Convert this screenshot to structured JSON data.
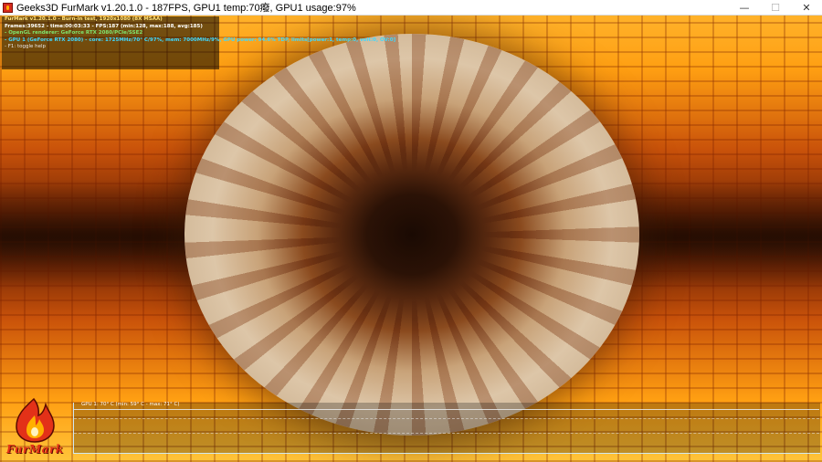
{
  "window": {
    "title": "Geeks3D FurMark v1.20.1.0 - 187FPS, GPU1 temp:70癈, GPU1 usage:97%",
    "controls": {
      "minimize": "—",
      "maximize": "☐",
      "close": "✕"
    }
  },
  "overlay": {
    "lines": [
      "FurMark v1.20.1.0 - Burn-in test, 1920x1080 (8X MSAA)",
      "Frames:39652 - time:00:03:33 - FPS:187 (min:128, max:188, avg:185)",
      "- OpenGL renderer: GeForce RTX 2080/PCIe/SSE2",
      "- GPU 1 (GeForce RTX 2080) - core: 1725MHz/70° C/97%, mem: 7000MHz/9%, GPU power: 94.6% TDP, limits[power:1, temp:0, volt:0, OV:0]",
      "- F1: toggle help"
    ]
  },
  "graph": {
    "label": "GPU 1: 70° C (min: 59° C - max: 71° C)"
  },
  "logo": {
    "text": "FurMark"
  },
  "colors": {
    "accent_red": "#e33118",
    "overlay_yellow": "#ffe17a",
    "overlay_green": "#7fe36e",
    "overlay_cyan": "#3fd8ff"
  }
}
